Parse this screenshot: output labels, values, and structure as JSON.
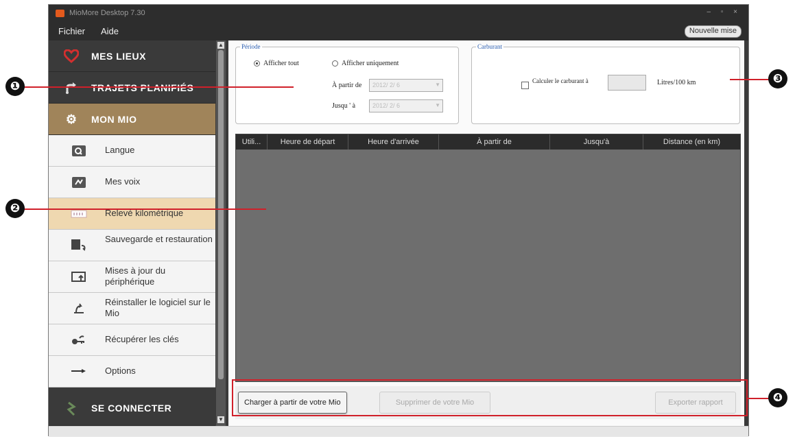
{
  "window": {
    "title": "MioMore Desktop 7.30",
    "controls": "– ▫ ×"
  },
  "menu": {
    "file": "Fichier",
    "help": "Aide",
    "update_button": "Nouvelle mise"
  },
  "sidebar": {
    "main": [
      {
        "label": "MES LIEUX",
        "icon": "heart-icon"
      },
      {
        "label": "TRAJETS PLANIFIÉS",
        "icon": "route-icon"
      },
      {
        "label": "MON MIO",
        "icon": "gear-icon"
      },
      {
        "label": "SE CONNECTER",
        "icon": "plug-icon"
      }
    ],
    "items": [
      {
        "label": "Langue",
        "icon": "language-icon"
      },
      {
        "label": "Mes voix",
        "icon": "voice-icon"
      },
      {
        "label": "Relevé kilométrique",
        "icon": "odometer-icon"
      },
      {
        "label": "Sauvegarde et restauration",
        "icon": "backup-icon"
      },
      {
        "label": "Mises à jour du périphérique",
        "icon": "device-update-icon"
      },
      {
        "label": "Réinstaller le logiciel sur le Mio",
        "icon": "reinstall-icon"
      },
      {
        "label": "Récupérer les clés",
        "icon": "key-icon"
      },
      {
        "label": "Options",
        "icon": "options-icon"
      }
    ],
    "selected_item": "Relevé kilométrique"
  },
  "period": {
    "legend": "Période",
    "show_all": "Afficher tout",
    "show_only": "Afficher uniquement",
    "from_label": "À partir de",
    "to_label": "Jusqu ' à",
    "from_value": "2012/ 2/ 6",
    "to_value": "2012/ 2/ 6",
    "selected": "Afficher tout"
  },
  "fuel": {
    "legend": "Carburant",
    "calc_label": "Calculer le carburant à",
    "unit": "Litres/100 km",
    "checked": false
  },
  "table": {
    "columns": [
      "Utili...",
      "Heure de départ",
      "Heure d'arrivée",
      "À partir de",
      "Jusqu'à",
      "Distance (en km)"
    ]
  },
  "buttons": {
    "load": "Charger à partir de votre Mio",
    "delete": "Supprimer de votre Mio",
    "export": "Exporter rapport"
  },
  "callouts": [
    "❶",
    "❷",
    "❸",
    "❹"
  ],
  "colors": {
    "callout_red": "#d0202a",
    "active_main": "#a0845a",
    "selected_item": "#efd8b0",
    "sidebar_bg": "#3a3a3a"
  }
}
